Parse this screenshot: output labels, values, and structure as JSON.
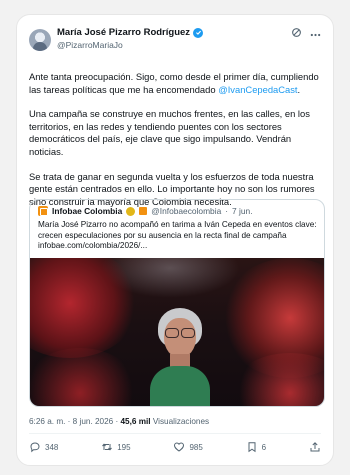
{
  "tweet": {
    "display_name": "María José Pizarro Rodríguez",
    "handle": "@PizarroMariaJo",
    "paragraphs": [
      {
        "before": "Ante tanta preocupación. Sigo, como desde el primer día, cumpliendo las tareas políticas que me ha encomendado ",
        "mention": "@IvanCepedaCast",
        "after": "."
      },
      {
        "text": "Una campaña se construye en muchos frentes, en las calles, en los territorios, en las redes y tendiendo puentes con los sectores democráticos del país, eje clave que sigo impulsando. Vendrán noticias."
      },
      {
        "text": "Se trata de ganar en segunda vuelta y los esfuerzos de toda nuestra gente están centrados en ello. Lo importante hoy no son los rumores sino construir la mayoría que Colombia necesita."
      }
    ],
    "quote": {
      "source": "Infobae Colombia",
      "handle": "@Infobaecolombia",
      "separator": "·",
      "date": "7 jun.",
      "text": "María José Pizarro no acompañó en tarima a Iván Cepeda en eventos clave: crecen especulaciones por su ausencia en la recta final de campaña infobae.com/colombia/2026/..."
    },
    "timestamp": "6:26 a. m. · 8 jun. 2026 ·",
    "views_count": "45,6 mil",
    "views_label": "Visualizaciones",
    "actions": {
      "replies": "348",
      "retweets": "195",
      "likes": "985",
      "bookmarks": "6"
    }
  },
  "colors": {
    "link": "#1d9bf0",
    "verified": "#1d9bf0",
    "muted": "#536471"
  }
}
